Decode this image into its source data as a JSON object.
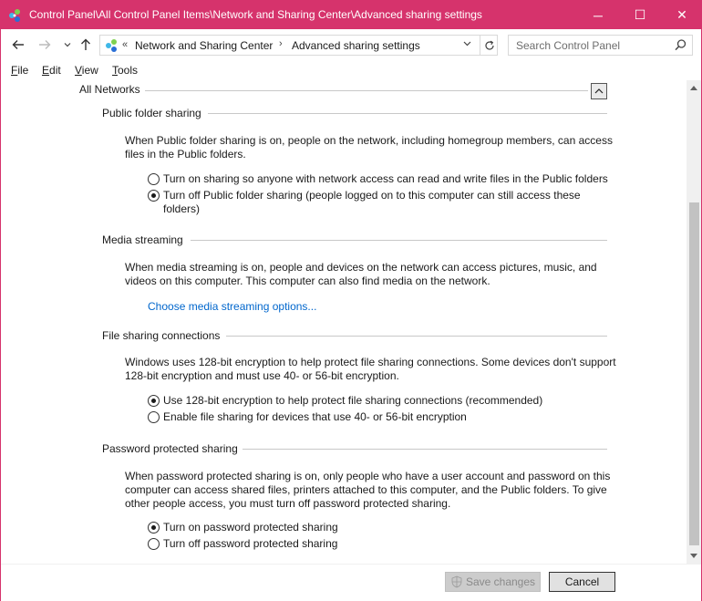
{
  "window": {
    "title": "Control Panel\\All Control Panel Items\\Network and Sharing Center\\Advanced sharing settings",
    "controls": {
      "minimize": "─",
      "maximize": "☐",
      "close": "✕"
    },
    "accent_color": "#d6336c"
  },
  "address_bar": {
    "chevron": "«",
    "crumbs": [
      "Network and Sharing Center",
      "Advanced sharing settings"
    ],
    "separator": "›",
    "search_placeholder": "Search Control Panel"
  },
  "menu": {
    "items": [
      {
        "key": "F",
        "rest": "ile"
      },
      {
        "key": "E",
        "rest": "dit"
      },
      {
        "key": "V",
        "rest": "iew"
      },
      {
        "key": "T",
        "rest": "ools"
      }
    ]
  },
  "content": {
    "group_title": "All Networks",
    "sections": {
      "public_folder": {
        "title": "Public folder sharing",
        "description": "When Public folder sharing is on, people on the network, including homegroup members, can access files in the Public folders.",
        "options": [
          {
            "label": "Turn on sharing so anyone with network access can read and write files in the Public folders",
            "checked": false
          },
          {
            "label": "Turn off Public folder sharing (people logged on to this computer can still access these folders)",
            "checked": true
          }
        ]
      },
      "media_streaming": {
        "title": "Media streaming",
        "description": "When media streaming is on, people and devices on the network can access pictures, music, and videos on this computer. This computer can also find media on the network.",
        "link": "Choose media streaming options..."
      },
      "file_sharing": {
        "title": "File sharing connections",
        "description": "Windows uses 128-bit encryption to help protect file sharing connections. Some devices don't support 128-bit encryption and must use 40- or 56-bit encryption.",
        "options": [
          {
            "label": "Use 128-bit encryption to help protect file sharing connections (recommended)",
            "checked": true
          },
          {
            "label": "Enable file sharing for devices that use 40- or 56-bit encryption",
            "checked": false
          }
        ]
      },
      "password_sharing": {
        "title": "Password protected sharing",
        "description": "When password protected sharing is on, only people who have a user account and password on this computer can access shared files, printers attached to this computer, and the Public folders. To give other people access, you must turn off password protected sharing.",
        "options": [
          {
            "label": "Turn on password protected sharing",
            "checked": true
          },
          {
            "label": "Turn off password protected sharing",
            "checked": false
          }
        ]
      }
    }
  },
  "footer": {
    "save_label": "Save changes",
    "cancel_label": "Cancel"
  }
}
